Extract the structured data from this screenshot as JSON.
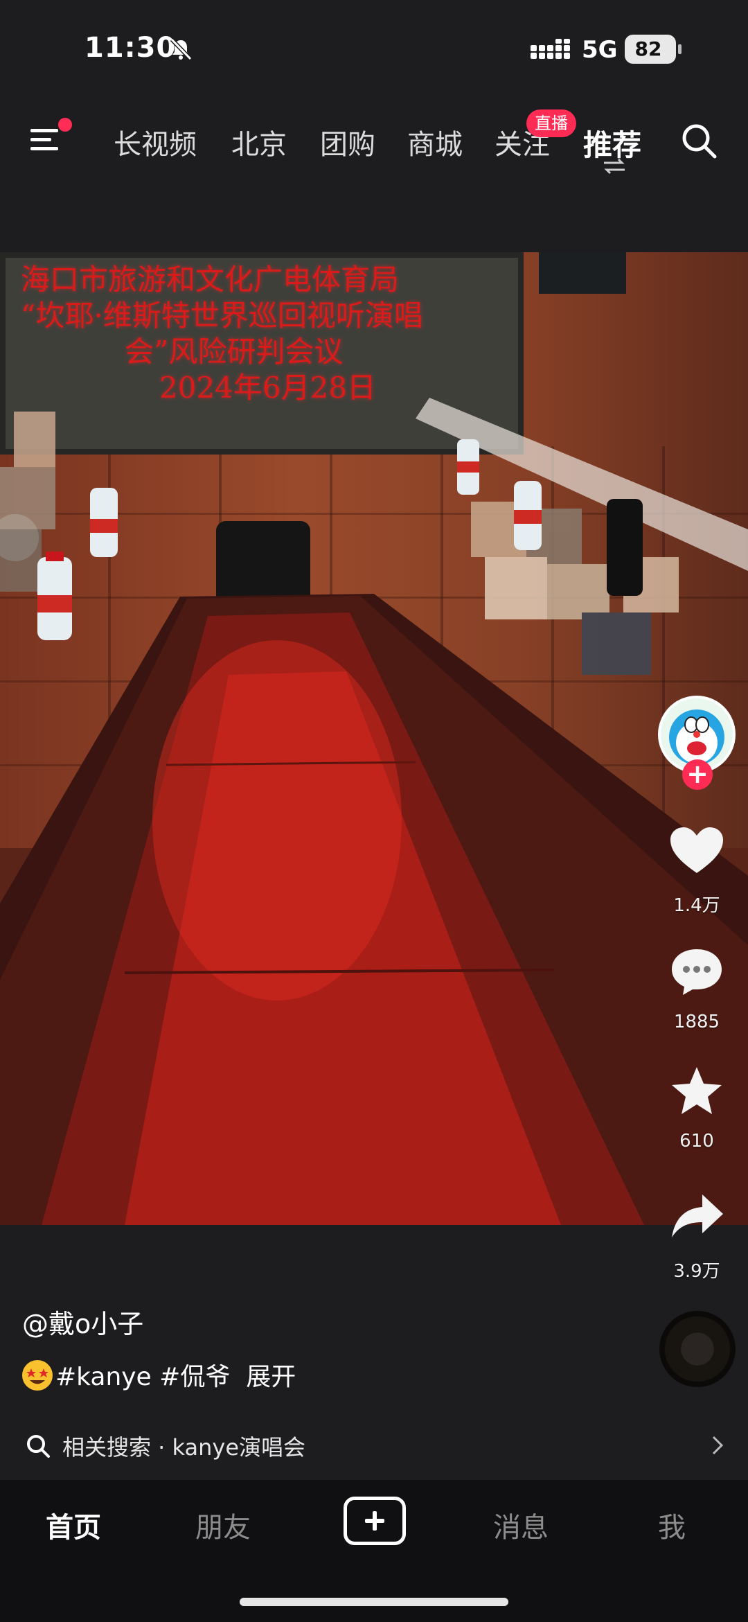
{
  "status_bar": {
    "time": "11:30",
    "network": "5G",
    "battery": "82"
  },
  "top_nav": {
    "tabs": [
      "长视频",
      "北京",
      "团购",
      "商城",
      "关注",
      "推荐"
    ],
    "live_badge": "直播",
    "active_tab": "推荐"
  },
  "video": {
    "screen_lines": [
      "海口市旅游和文化广电体育局",
      "“坎耶·维斯特世界巡回视听演唱",
      "会”风险研判会议",
      "2024年6月28日"
    ]
  },
  "actions": {
    "likes": "1.4万",
    "comments": "1885",
    "favorites": "610",
    "shares": "3.9万"
  },
  "post": {
    "author": "@戴o小子",
    "caption": "#kanye #侃爷",
    "expand": "展开"
  },
  "related": {
    "text": "相关搜索 · kanye演唱会"
  },
  "bottom_nav": {
    "home": "首页",
    "friends": "朋友",
    "messages": "消息",
    "me": "我"
  },
  "colors": {
    "accent": "#fe2c55",
    "background": "#1d1c1f",
    "nav_background": "#101012"
  }
}
